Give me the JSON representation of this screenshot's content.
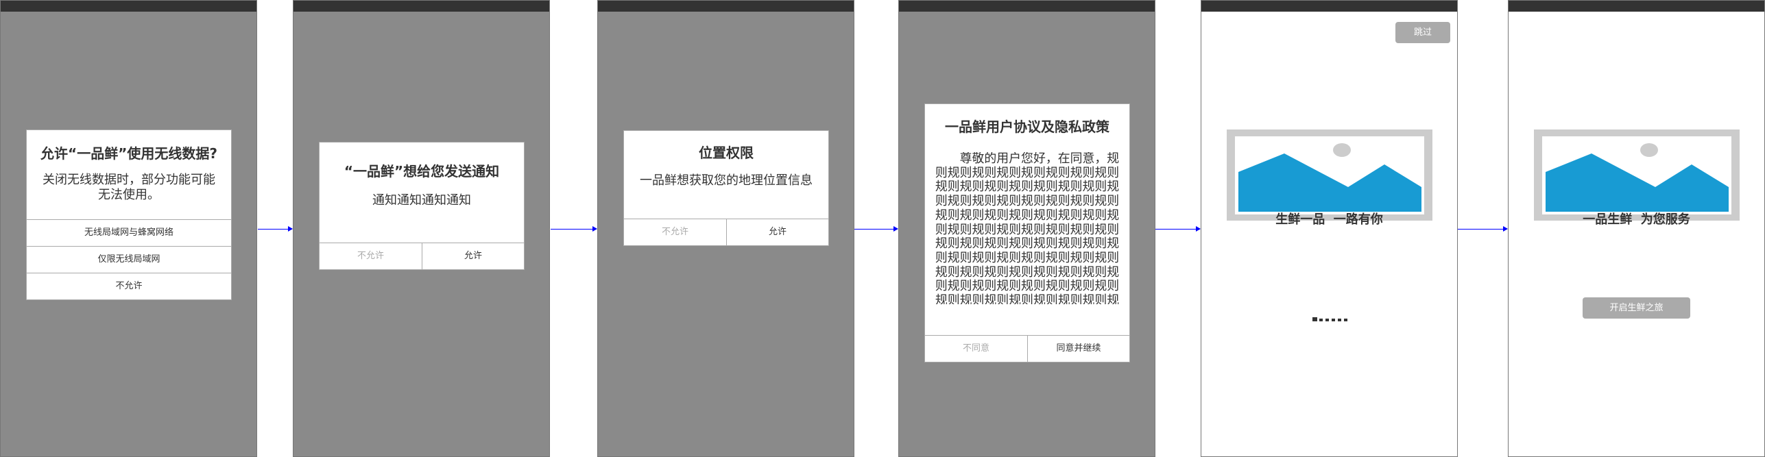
{
  "colors": {
    "overlay": "#8a8a8a",
    "statusbar": "#333333",
    "image_accent": "#189bd3",
    "button_gray": "#aaaaaa",
    "arrow": "#0000ff"
  },
  "screens": [
    {
      "dialog": {
        "title": "允许“一品鲜”使用无线数据?",
        "body": "关闭无线数据时，部分功能可能无法使用。",
        "options": [
          "无线局域网与蜂窝网络",
          "仅限无线局域网",
          "不允许"
        ]
      }
    },
    {
      "dialog": {
        "title": "“一品鲜”想给您发送通知",
        "body": "通知通知通知通知",
        "deny": "不允许",
        "allow": "允许"
      }
    },
    {
      "dialog": {
        "title": "位置权限",
        "body": "一品鲜想获取您的地理位置信息",
        "deny": "不允许",
        "allow": "允许"
      }
    },
    {
      "dialog": {
        "title": "一品鲜用户协议及隐私政策",
        "body": "尊敬的用户您好，在同意，规则规则规则规则规则规则规则规则规则规则规则规则规则规则规则规则规则规则规则规则规则规则规则规则规则规则规则规则规则规则规则规则规则规则规则规则规则规则规则规则规则规则规则规则规则规则规则规则规则规则规则规则规则规则规则规则规则规则规则规则规则规则规则规则规则规则规则规则规则规则规则规则规则规则规则规则规则规则规则规则规则规则规则规则规则规则规则规则规则规则规则规则规则规则规则规则规则规则规则规则规则规则",
        "deny": "不同意",
        "allow": "同意并继续"
      }
    },
    {
      "skip": "跳过",
      "tagline": "生鲜一品  一路有你",
      "page_indicator": {
        "total": 6,
        "current": 1
      }
    },
    {
      "tagline": "一品生鲜  为您服务",
      "start_button": "开启生鲜之旅"
    }
  ]
}
